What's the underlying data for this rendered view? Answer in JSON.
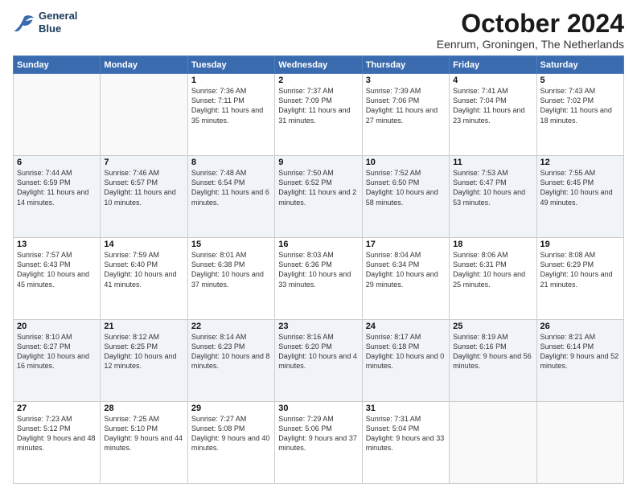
{
  "logo": {
    "line1": "General",
    "line2": "Blue"
  },
  "title": "October 2024",
  "subtitle": "Eenrum, Groningen, The Netherlands",
  "days_of_week": [
    "Sunday",
    "Monday",
    "Tuesday",
    "Wednesday",
    "Thursday",
    "Friday",
    "Saturday"
  ],
  "weeks": [
    [
      {
        "day": "",
        "detail": ""
      },
      {
        "day": "",
        "detail": ""
      },
      {
        "day": "1",
        "detail": "Sunrise: 7:36 AM\nSunset: 7:11 PM\nDaylight: 11 hours\nand 35 minutes."
      },
      {
        "day": "2",
        "detail": "Sunrise: 7:37 AM\nSunset: 7:09 PM\nDaylight: 11 hours\nand 31 minutes."
      },
      {
        "day": "3",
        "detail": "Sunrise: 7:39 AM\nSunset: 7:06 PM\nDaylight: 11 hours\nand 27 minutes."
      },
      {
        "day": "4",
        "detail": "Sunrise: 7:41 AM\nSunset: 7:04 PM\nDaylight: 11 hours\nand 23 minutes."
      },
      {
        "day": "5",
        "detail": "Sunrise: 7:43 AM\nSunset: 7:02 PM\nDaylight: 11 hours\nand 18 minutes."
      }
    ],
    [
      {
        "day": "6",
        "detail": "Sunrise: 7:44 AM\nSunset: 6:59 PM\nDaylight: 11 hours\nand 14 minutes."
      },
      {
        "day": "7",
        "detail": "Sunrise: 7:46 AM\nSunset: 6:57 PM\nDaylight: 11 hours\nand 10 minutes."
      },
      {
        "day": "8",
        "detail": "Sunrise: 7:48 AM\nSunset: 6:54 PM\nDaylight: 11 hours\nand 6 minutes."
      },
      {
        "day": "9",
        "detail": "Sunrise: 7:50 AM\nSunset: 6:52 PM\nDaylight: 11 hours\nand 2 minutes."
      },
      {
        "day": "10",
        "detail": "Sunrise: 7:52 AM\nSunset: 6:50 PM\nDaylight: 10 hours\nand 58 minutes."
      },
      {
        "day": "11",
        "detail": "Sunrise: 7:53 AM\nSunset: 6:47 PM\nDaylight: 10 hours\nand 53 minutes."
      },
      {
        "day": "12",
        "detail": "Sunrise: 7:55 AM\nSunset: 6:45 PM\nDaylight: 10 hours\nand 49 minutes."
      }
    ],
    [
      {
        "day": "13",
        "detail": "Sunrise: 7:57 AM\nSunset: 6:43 PM\nDaylight: 10 hours\nand 45 minutes."
      },
      {
        "day": "14",
        "detail": "Sunrise: 7:59 AM\nSunset: 6:40 PM\nDaylight: 10 hours\nand 41 minutes."
      },
      {
        "day": "15",
        "detail": "Sunrise: 8:01 AM\nSunset: 6:38 PM\nDaylight: 10 hours\nand 37 minutes."
      },
      {
        "day": "16",
        "detail": "Sunrise: 8:03 AM\nSunset: 6:36 PM\nDaylight: 10 hours\nand 33 minutes."
      },
      {
        "day": "17",
        "detail": "Sunrise: 8:04 AM\nSunset: 6:34 PM\nDaylight: 10 hours\nand 29 minutes."
      },
      {
        "day": "18",
        "detail": "Sunrise: 8:06 AM\nSunset: 6:31 PM\nDaylight: 10 hours\nand 25 minutes."
      },
      {
        "day": "19",
        "detail": "Sunrise: 8:08 AM\nSunset: 6:29 PM\nDaylight: 10 hours\nand 21 minutes."
      }
    ],
    [
      {
        "day": "20",
        "detail": "Sunrise: 8:10 AM\nSunset: 6:27 PM\nDaylight: 10 hours\nand 16 minutes."
      },
      {
        "day": "21",
        "detail": "Sunrise: 8:12 AM\nSunset: 6:25 PM\nDaylight: 10 hours\nand 12 minutes."
      },
      {
        "day": "22",
        "detail": "Sunrise: 8:14 AM\nSunset: 6:23 PM\nDaylight: 10 hours\nand 8 minutes."
      },
      {
        "day": "23",
        "detail": "Sunrise: 8:16 AM\nSunset: 6:20 PM\nDaylight: 10 hours\nand 4 minutes."
      },
      {
        "day": "24",
        "detail": "Sunrise: 8:17 AM\nSunset: 6:18 PM\nDaylight: 10 hours\nand 0 minutes."
      },
      {
        "day": "25",
        "detail": "Sunrise: 8:19 AM\nSunset: 6:16 PM\nDaylight: 9 hours\nand 56 minutes."
      },
      {
        "day": "26",
        "detail": "Sunrise: 8:21 AM\nSunset: 6:14 PM\nDaylight: 9 hours\nand 52 minutes."
      }
    ],
    [
      {
        "day": "27",
        "detail": "Sunrise: 7:23 AM\nSunset: 5:12 PM\nDaylight: 9 hours\nand 48 minutes."
      },
      {
        "day": "28",
        "detail": "Sunrise: 7:25 AM\nSunset: 5:10 PM\nDaylight: 9 hours\nand 44 minutes."
      },
      {
        "day": "29",
        "detail": "Sunrise: 7:27 AM\nSunset: 5:08 PM\nDaylight: 9 hours\nand 40 minutes."
      },
      {
        "day": "30",
        "detail": "Sunrise: 7:29 AM\nSunset: 5:06 PM\nDaylight: 9 hours\nand 37 minutes."
      },
      {
        "day": "31",
        "detail": "Sunrise: 7:31 AM\nSunset: 5:04 PM\nDaylight: 9 hours\nand 33 minutes."
      },
      {
        "day": "",
        "detail": ""
      },
      {
        "day": "",
        "detail": ""
      }
    ]
  ]
}
